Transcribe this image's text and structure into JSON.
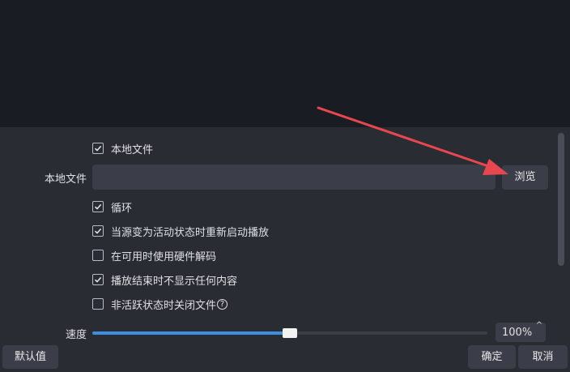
{
  "form": {
    "local_file_checkbox": {
      "label": "本地文件",
      "checked": true
    },
    "local_file_field": {
      "label": "本地文件",
      "value": ""
    },
    "browse_button": "浏览",
    "options": [
      {
        "key": "loop",
        "label": "循环",
        "checked": true
      },
      {
        "key": "restart",
        "label": "当源变为活动状态时重新启动播放",
        "checked": true
      },
      {
        "key": "hwdecode",
        "label": "在可用时使用硬件解码",
        "checked": false
      },
      {
        "key": "hide_end",
        "label": "播放结束时不显示任何内容",
        "checked": true
      },
      {
        "key": "close_inactive",
        "label": "非活跃状态时关闭文件",
        "checked": false,
        "help_icon": "question-circle-icon"
      }
    ],
    "speed": {
      "label": "速度",
      "value": 0.5,
      "display": "100%"
    }
  },
  "footer": {
    "defaults_button": "默认值",
    "ok_button": "确定",
    "cancel_button": "取消"
  },
  "colors": {
    "accent": "#3b8ee0",
    "annotation_arrow": "#e8474f",
    "panel_bg": "#2a2c33",
    "preview_bg": "#1a1c23"
  }
}
